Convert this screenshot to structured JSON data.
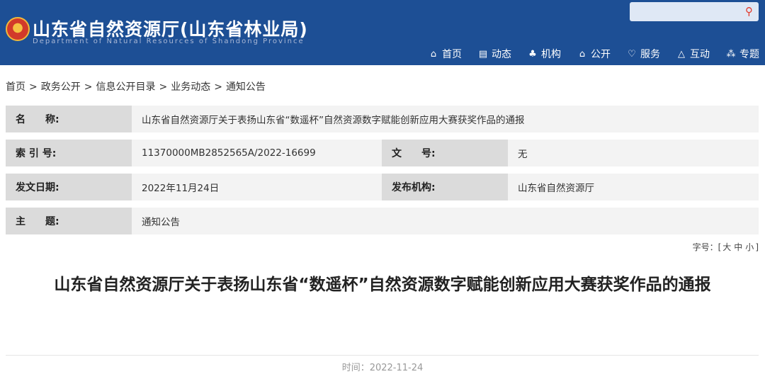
{
  "header": {
    "title": "山东省自然资源厅(山东省林业局)",
    "subtitle": "Department of Natural Resources of Shandong Province",
    "search": {
      "placeholder": "",
      "icon": "search-icon"
    },
    "nav": [
      {
        "label": "首页",
        "icon": "home-icon",
        "glyph": "⌂"
      },
      {
        "label": "动态",
        "icon": "news-icon",
        "glyph": "▤"
      },
      {
        "label": "机构",
        "icon": "organization-icon",
        "glyph": "♣"
      },
      {
        "label": "公开",
        "icon": "lock-icon",
        "glyph": "⌂"
      },
      {
        "label": "服务",
        "icon": "heart-icon",
        "glyph": "♡"
      },
      {
        "label": "互动",
        "icon": "interaction-icon",
        "glyph": "△"
      },
      {
        "label": "专题",
        "icon": "topic-icon",
        "glyph": "⁂"
      }
    ]
  },
  "breadcrumb": [
    "首页",
    "政务公开",
    "信息公开目录",
    "业务动态",
    "通知公告"
  ],
  "breadcrumb_separator": ">",
  "info": {
    "name_label": "名　　称:",
    "name_value": "山东省自然资源厅关于表扬山东省“数遥杯”自然资源数字赋能创新应用大赛获奖作品的通报",
    "index_label": "索 引 号:",
    "index_value": "11370000MB2852565A/2022-16699",
    "docno_label": "文　　号:",
    "docno_value": "无",
    "date_label": "发文日期:",
    "date_value": "2022年11月24日",
    "org_label": "发布机构:",
    "org_value": "山东省自然资源厅",
    "topic_label": "主　　题:",
    "topic_value": "通知公告"
  },
  "font_size": {
    "label": "字号：[",
    "large": "大",
    "medium": "中",
    "small": "小",
    "close": "]"
  },
  "article": {
    "title": "山东省自然资源厅关于表扬山东省“数遥杯”自然资源数字赋能创新应用大赛获奖作品的通报",
    "time_label": "时间：",
    "time_value": "2022-11-24"
  },
  "colors": {
    "header_bg": "#1d4f95",
    "label_bg": "#dbdbdb",
    "value_bg": "#f3f3f3"
  }
}
